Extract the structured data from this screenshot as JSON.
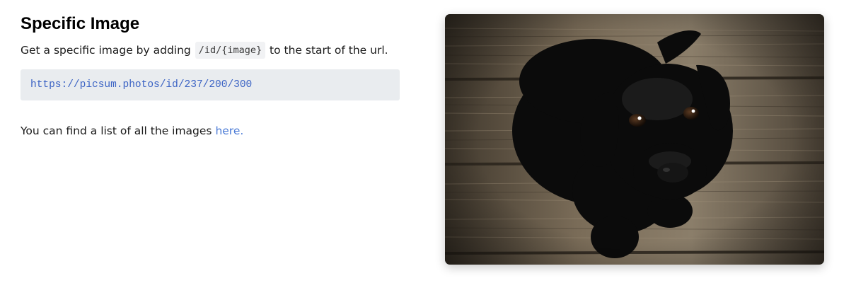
{
  "section": {
    "title": "Specific Image",
    "description_before": "Get a specific image by adding ",
    "inline_code": "/id/{image}",
    "description_after": " to the start of the url.",
    "code_url": "https://picsum.photos/id/237/200/300",
    "list_text": "You can find a list of all the images ",
    "link_text": "here."
  },
  "image": {
    "subject": "black puppy on wooden floor"
  },
  "colors": {
    "link": "#4b7bd6",
    "code_text": "#3b63c4",
    "code_bg": "#e9ecef"
  }
}
